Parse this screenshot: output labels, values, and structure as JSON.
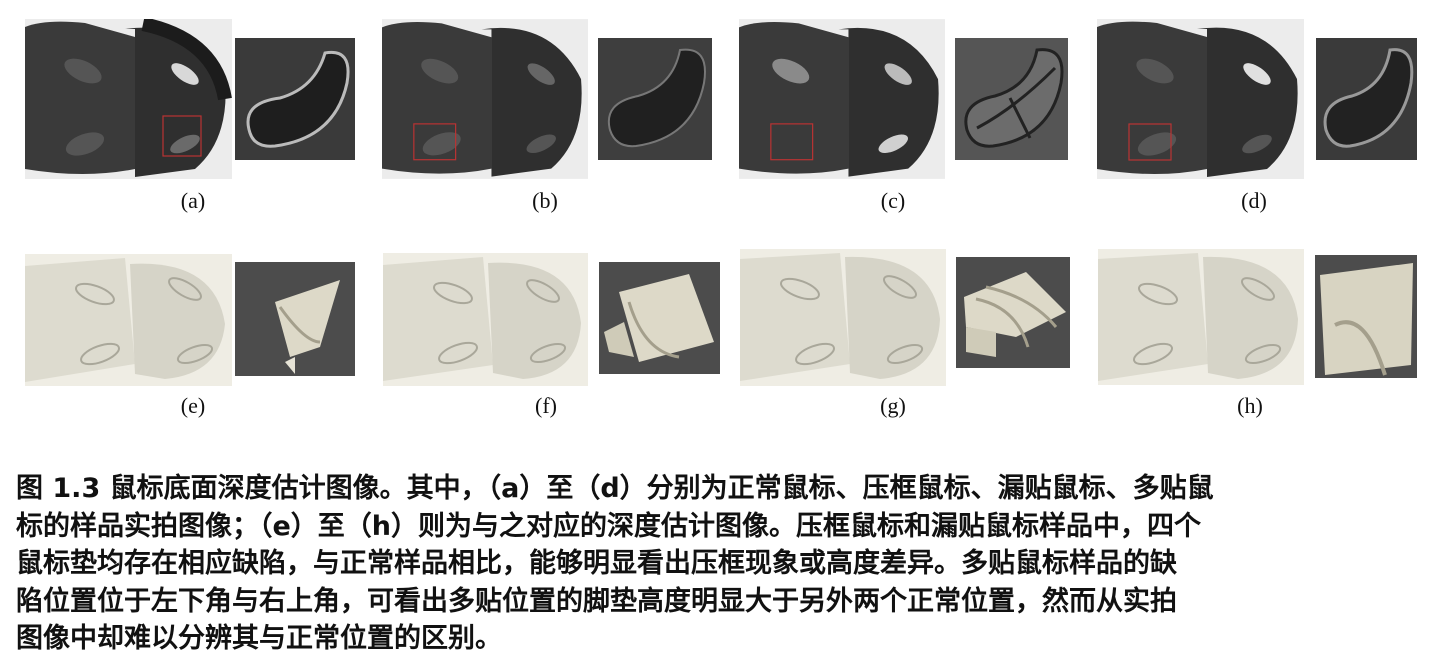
{
  "figure": {
    "subfigure_labels": [
      "(a)",
      "(b)",
      "(c)",
      "(d)",
      "(e)",
      "(f)",
      "(g)",
      "(h)"
    ],
    "caption_lines": [
      "图 1.3  鼠标底面深度估计图像。其中，（a）至（d）分别为正常鼠标、压框鼠标、漏贴鼠标、多贴鼠",
      "标的样品实拍图像；（e）至（h）则为与之对应的深度估计图像。压框鼠标和漏贴鼠标样品中，四个",
      "鼠标垫均存在相应缺陷，与正常样品相比，能够明显看出压框现象或高度差异。多贴鼠标样品的缺",
      "陷位置位于左下角与右上角，可看出多贴位置的脚垫高度明显大于另外两个正常位置，然而从实拍",
      "图像中却难以分辨其与正常位置的区别。"
    ]
  }
}
